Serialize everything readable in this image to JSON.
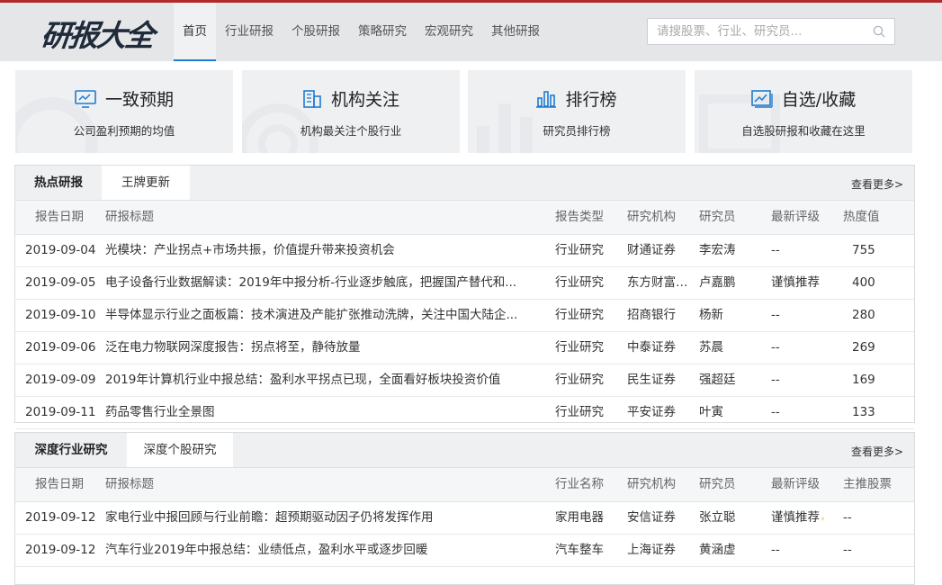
{
  "logo": {
    "text_a": "研报",
    "text_b": "大全"
  },
  "nav": {
    "items": [
      "首页",
      "行业研报",
      "个股研报",
      "策略研究",
      "宏观研究",
      "其他研报"
    ]
  },
  "search": {
    "placeholder": "请搜股票、行业、研究员..."
  },
  "cards": [
    {
      "title": "一致预期",
      "subtitle": "公司盈利预期的均值"
    },
    {
      "title": "机构关注",
      "subtitle": "机构最关注个股行业"
    },
    {
      "title": "排行榜",
      "subtitle": "研究员排行榜"
    },
    {
      "title": "自选/收藏",
      "subtitle": "自选股研报和收藏在这里"
    }
  ],
  "hot": {
    "tabs": [
      "热点研报",
      "王牌更新"
    ],
    "more": "查看更多>",
    "headers": [
      "报告日期",
      "研报标题",
      "报告类型",
      "研究机构",
      "研究员",
      "最新评级",
      "热度值"
    ],
    "rows": [
      [
        "2019-09-04",
        "光模块：产业拐点+市场共振，价值提升带来投资机会",
        "行业研究",
        "财通证券",
        "李宏涛",
        "--",
        "755"
      ],
      [
        "2019-09-05",
        "电子设备行业数据解读：2019年中报分析-行业逐步触底，把握国产替代和...",
        "行业研究",
        "东方财富证...",
        "卢嘉鹏",
        "谨慎推荐",
        "400"
      ],
      [
        "2019-09-10",
        "半导体显示行业之面板篇：技术演进及产能扩张推动洗牌，关注中国大陆企...",
        "行业研究",
        "招商银行",
        "杨新",
        "--",
        "280"
      ],
      [
        "2019-09-06",
        "泛在电力物联网深度报告：拐点将至，静待放量",
        "行业研究",
        "中泰证券",
        "苏晨",
        "--",
        "269"
      ],
      [
        "2019-09-09",
        "2019年计算机行业中报总结：盈利水平拐点已现，全面看好板块投资价值",
        "行业研究",
        "民生证券",
        "强超廷",
        "--",
        "169"
      ],
      [
        "2019-09-11",
        "药品零售行业全景图",
        "行业研究",
        "平安证券",
        "叶寅",
        "--",
        "133"
      ]
    ]
  },
  "deep": {
    "tabs": [
      "深度行业研究",
      "深度个股研究"
    ],
    "more": "查看更多>",
    "headers": [
      "报告日期",
      "研报标题",
      "行业名称",
      "研究机构",
      "研究员",
      "最新评级",
      "主推股票"
    ],
    "rows": [
      [
        "2019-09-12",
        "家电行业中报回顾与行业前瞻：超预期驱动因子仍将发挥作用",
        "家用电器",
        "安信证券",
        "张立聪",
        "谨慎推荐",
        "--"
      ],
      [
        "2019-09-12",
        "汽车行业2019年中报总结：业绩低点，盈利水平或逐步回暖",
        "汽车整车",
        "上海证券",
        "黄涵虚",
        "--",
        "--"
      ]
    ]
  },
  "colors": {
    "accent": "#1f7bd1",
    "header_bg": "#e5e6e8",
    "top_line": "#b12b2b",
    "card_bg": "#eef0f2"
  }
}
